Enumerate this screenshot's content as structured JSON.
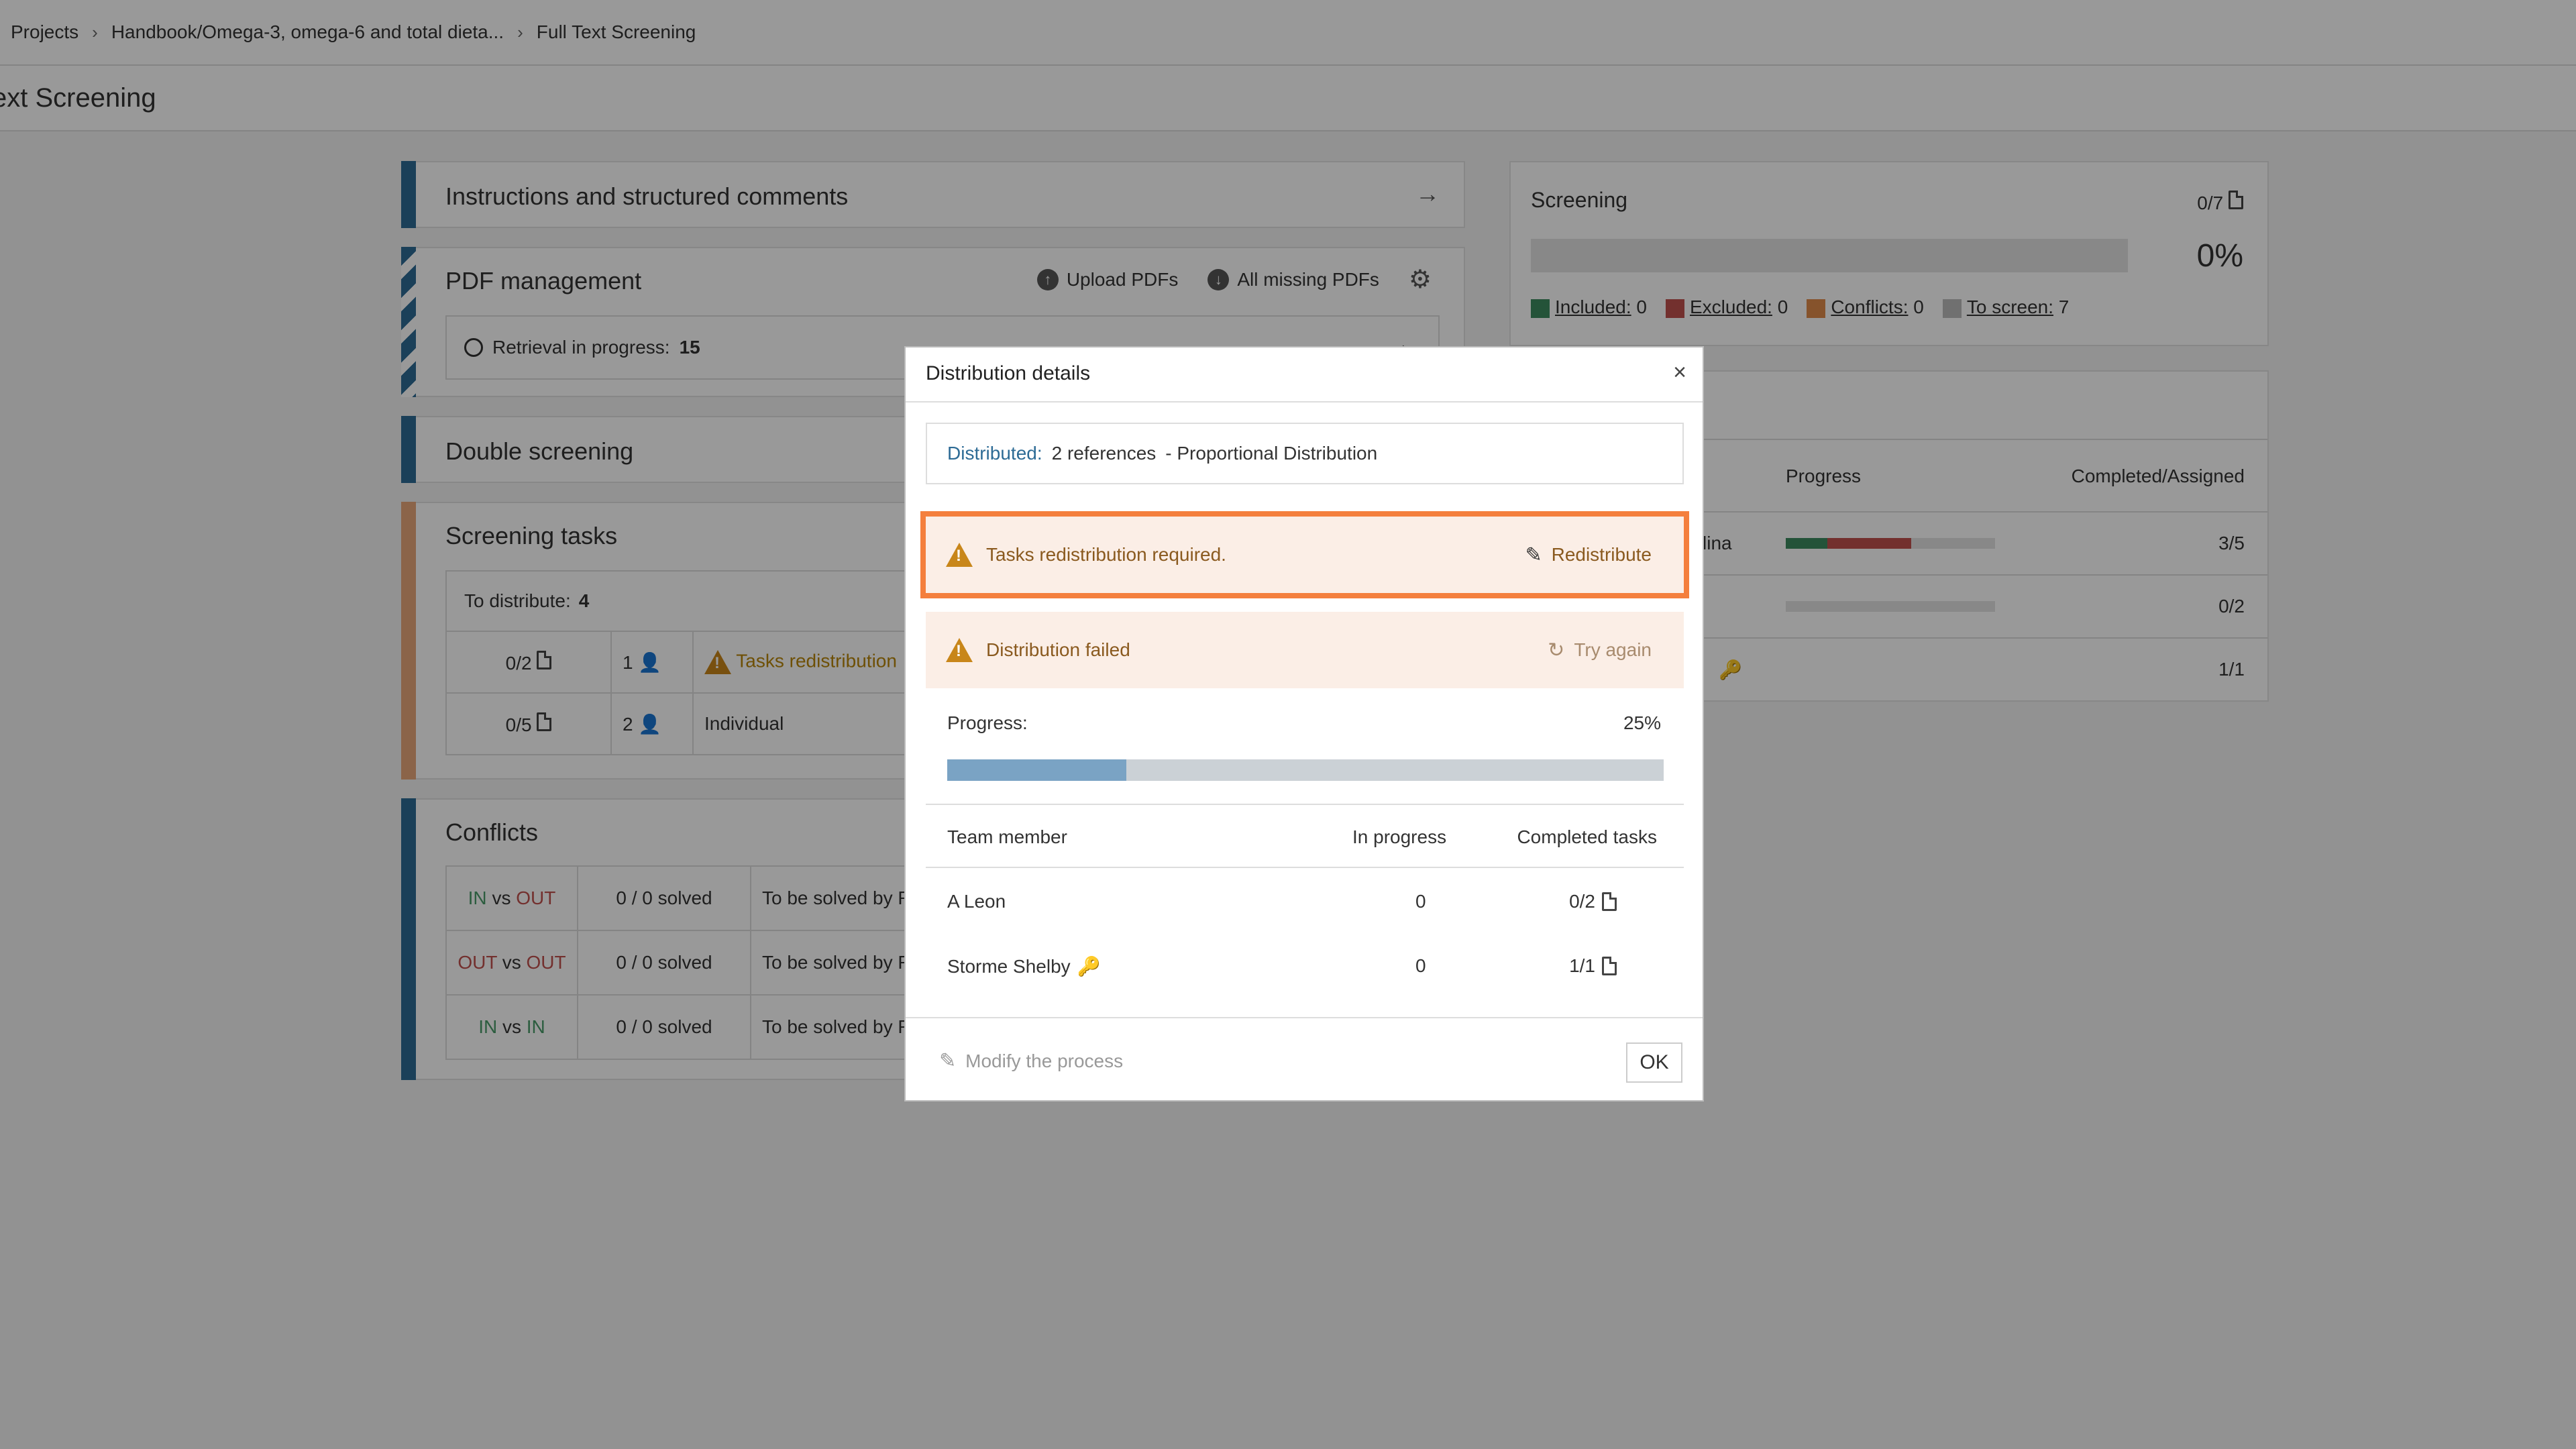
{
  "breadcrumb": {
    "items": [
      "Projects",
      "Handbook/Omega-3, omega-6 and total dieta...",
      "Full Text Screening"
    ],
    "separator": "›"
  },
  "page_title": "ext Screening",
  "panels": {
    "instructions": {
      "title": "Instructions and structured comments"
    },
    "pdf": {
      "title": "PDF management",
      "upload_label": "Upload PDFs",
      "missing_label": "All missing PDFs",
      "retrieval_label": "Retrieval in progress:",
      "retrieval_count": "15"
    },
    "double": {
      "title": "Double screening"
    },
    "tasks": {
      "title": "Screening tasks",
      "to_distribute_label": "To distribute:",
      "to_distribute_value": "4",
      "rows": [
        {
          "count": "0/2",
          "members": "1",
          "status": "Tasks redistribution"
        },
        {
          "count": "0/5",
          "members": "2",
          "status": "Individual"
        }
      ]
    },
    "conflicts": {
      "title": "Conflicts",
      "rows": [
        {
          "a": "IN",
          "vs": "vs",
          "b": "OUT",
          "solved": "0 / 0 solved",
          "note": "To be solved by R"
        },
        {
          "a": "OUT",
          "vs": "vs",
          "b": "OUT",
          "solved": "0 / 0 solved",
          "note": "To be solved by R"
        },
        {
          "a": "IN",
          "vs": "vs",
          "b": "IN",
          "solved": "0 / 0 solved",
          "note": "To be solved by R"
        }
      ]
    },
    "screening": {
      "title": "Screening",
      "count": "0/7",
      "percent": "0%",
      "legend": [
        {
          "label": "Included:",
          "value": "0",
          "color": "#3d8b5f"
        },
        {
          "label": "Excluded:",
          "value": "0",
          "color": "#c0504d"
        },
        {
          "label": "Conflicts:",
          "value": "0",
          "color": "#e08a4a"
        },
        {
          "label": "To screen:",
          "value": "7",
          "color": "#bbbbbb"
        }
      ]
    },
    "team": {
      "progress_header": "Progress",
      "completed_header": "Completed/Assigned",
      "rows": [
        {
          "name": "lina",
          "value": "3/5",
          "green": 0.2,
          "red": 0.4
        },
        {
          "name": "",
          "value": "0/2",
          "green": 0,
          "red": 0
        },
        {
          "name": "",
          "value": "1/1",
          "green": 0,
          "red": 0
        }
      ]
    }
  },
  "modal": {
    "title": "Distribution details",
    "close": "×",
    "distributed_label": "Distributed:",
    "distributed_refs": "2 references",
    "distributed_method": "- Proportional Distribution",
    "redistribution_alert": "Tasks redistribution required.",
    "redistribute_label": "Redistribute",
    "failed_alert": "Distribution failed",
    "try_again_label": "Try again",
    "progress_label": "Progress:",
    "progress_value": "25%",
    "progress_fraction": 0.25,
    "table": {
      "headers": [
        "Team member",
        "In progress",
        "Completed tasks"
      ],
      "rows": [
        {
          "member": "A Leon",
          "in_progress": "0",
          "completed": "0/2"
        },
        {
          "member": "Storme Shelby",
          "in_progress": "0",
          "completed": "1/1"
        }
      ]
    },
    "modify_label": "Modify the process",
    "ok_label": "OK"
  }
}
